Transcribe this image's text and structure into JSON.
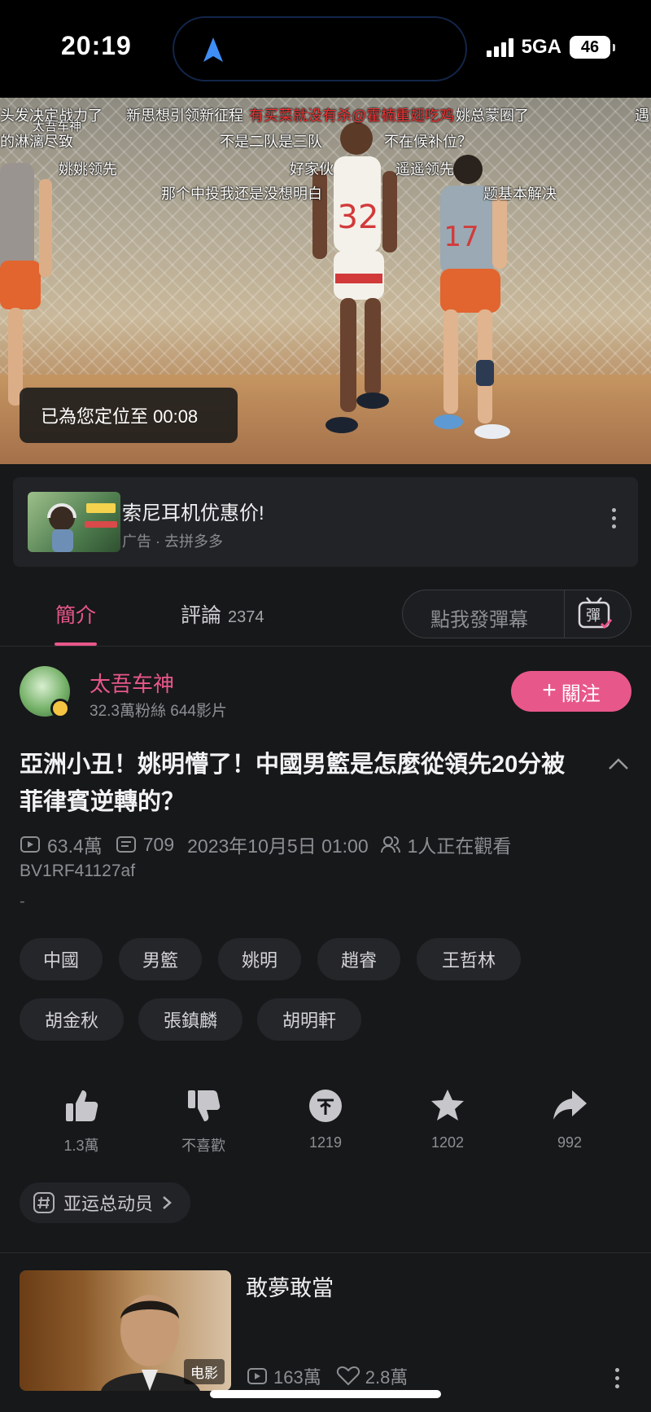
{
  "status_bar": {
    "time": "20:19",
    "network": "5GA",
    "battery": "46"
  },
  "video": {
    "toast": "已為您定位至 00:08",
    "danmaku": [
      "头发决定战力了",
      "新思想引领新征程",
      "有买菜就没有杀@霍楠重翅吃鸡",
      "姚总蒙圈了",
      "遇",
      "的淋漓尽致",
      "太吾车神",
      "不是二队是三队",
      "不在候补位？",
      "姚姚领先",
      "好家伙",
      "遥遥领先",
      "那个中投我还是没想明白",
      "题基本解决"
    ],
    "jersey_numbers": [
      "32",
      "17"
    ]
  },
  "ad": {
    "title": "索尼耳机优惠价!",
    "subtitle": "广告 · 去拼多多"
  },
  "tabs": {
    "intro": "簡介",
    "comments": "評論",
    "comments_count": "2374",
    "danmu_placeholder": "點我發彈幕",
    "danmu_icon_label": "彈"
  },
  "uploader": {
    "name": "太吾车神",
    "meta": "32.3萬粉絲  644影片",
    "follow_label": "關注"
  },
  "video_info": {
    "title": "亞洲小丑！姚明懵了！中國男籃是怎麼從領先20分被菲律賓逆轉的？",
    "views": "63.4萬",
    "danmaku_count": "709",
    "date": "2023年10月5日 01:00",
    "watching": "1人正在觀看",
    "bvid": "BV1RF41127af",
    "desc": "-"
  },
  "tags": [
    "中國",
    "男籃",
    "姚明",
    "趙睿",
    "王哲林",
    "胡金秋",
    "張鎮麟",
    "胡明軒"
  ],
  "actions": {
    "like": "1.3萬",
    "dislike": "不喜歡",
    "coin": "1219",
    "favorite": "1202",
    "share": "992"
  },
  "topic": "亚运总动员",
  "related": {
    "title": "敢夢敢當",
    "badge": "电影",
    "views": "163萬",
    "likes": "2.8萬"
  },
  "colors": {
    "accent": "#e8578a",
    "background": "#17181a"
  }
}
